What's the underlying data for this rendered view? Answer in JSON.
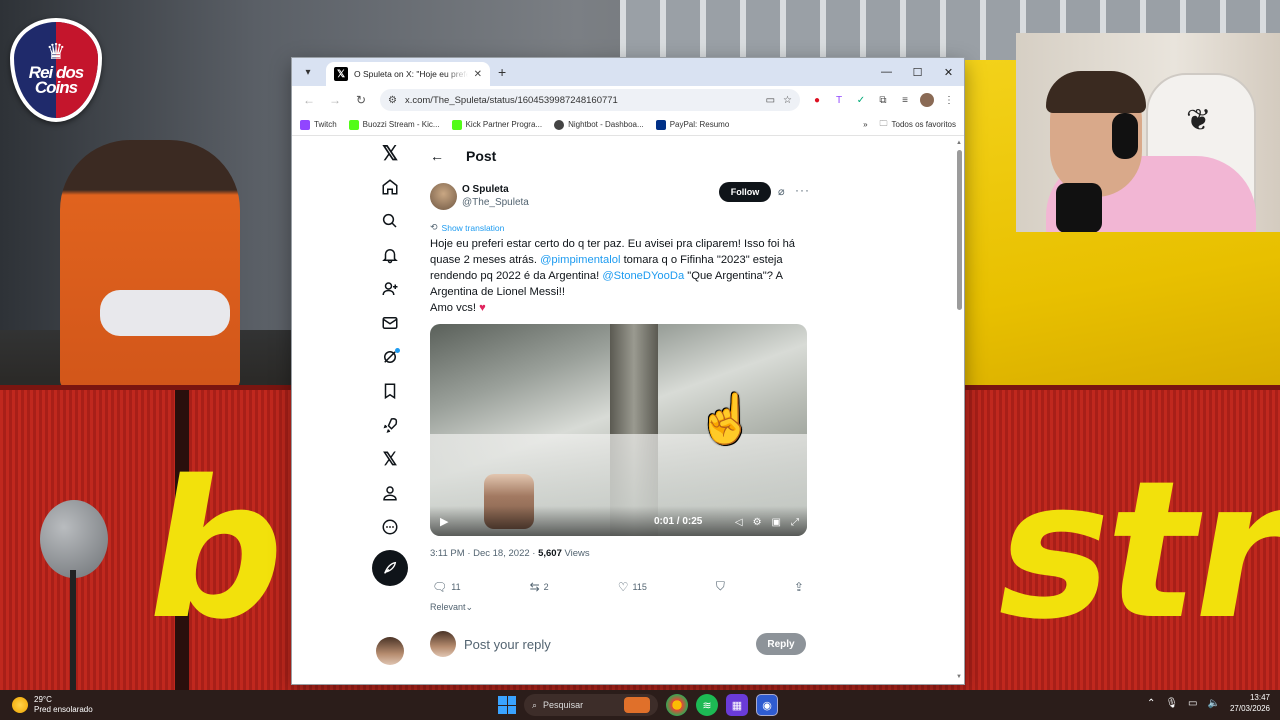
{
  "overlay": {
    "logo_text": "Rei dos Coins"
  },
  "browser": {
    "tab_title": "O Spuleta on X: \"Hoje eu prefe",
    "url": "x.com/The_Spuleta/status/1604539987248160771",
    "bookmarks": [
      "Twitch",
      "Buozzi Stream - Kic...",
      "Kick Partner Progra...",
      "Nightbot - Dashboa...",
      "PayPal: Resumo"
    ],
    "all_bookmarks": "Todos os favoritos"
  },
  "post": {
    "header": "Post",
    "author_name": "O Spuleta",
    "author_handle": "@The_Spuleta",
    "follow_label": "Follow",
    "translate": "Show translation",
    "text_1": "Hoje eu preferi estar certo do q ter paz. Eu avisei pra cliparem! Isso foi há quase 2 meses atrás. ",
    "mention_1": "@pimpimentalol",
    "text_2": " tomara q o Fifinha \"2023\" esteja rendendo pq 2022 é da Argentina! ",
    "mention_2": "@StoneDYooDa",
    "text_3": " \"Que Argentina\"? A Argentina de Lionel Messi!!",
    "text_4": "Amo vcs! ",
    "heart": "♥",
    "video_time": "0:01 / 0:25",
    "timestamp": "3:11 PM · Dec 18, 2022 · ",
    "views_count": "5,607",
    "views_label": " Views",
    "replies": "11",
    "reposts": "2",
    "likes": "115",
    "sort_label": "Relevant",
    "reply_placeholder": "Post your reply",
    "reply_button": "Reply"
  },
  "taskbar": {
    "temp": "29°C",
    "weather": "Pred ensolarado",
    "search_placeholder": "Pesquisar",
    "time": "13:47",
    "date": "27/03/2026"
  }
}
